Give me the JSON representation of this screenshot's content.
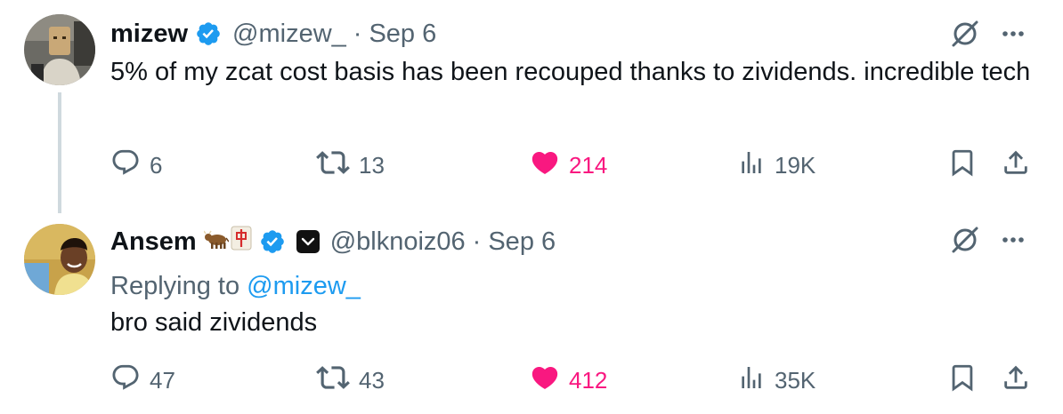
{
  "tweets": [
    {
      "display_name": "mizew",
      "handle": "@mizew_",
      "separator": "·",
      "date": "Sep 6",
      "text": "5% of my zcat cost basis has been recouped thanks to zividends. incredible tech",
      "actions": {
        "replies": "6",
        "retweets": "13",
        "likes": "214",
        "views": "19K"
      },
      "verified": true,
      "liked": true
    },
    {
      "display_name": "Ansem",
      "emojis": [
        "🐂",
        "🀄"
      ],
      "handle": "@blknoiz06",
      "separator": "·",
      "date": "Sep 6",
      "replying_prefix": "Replying to",
      "replying_to": "@mizew_",
      "text": "bro said zividends",
      "actions": {
        "replies": "47",
        "retweets": "43",
        "likes": "412",
        "views": "35K"
      },
      "verified": true,
      "liked": true
    }
  ],
  "colors": {
    "text": "#0f1419",
    "secondary": "#536471",
    "link": "#1d9bf0",
    "like": "#f91880",
    "verified": "#1d9bf0",
    "thread_line": "#cfd9de"
  },
  "icons": [
    "verified-badge-icon",
    "grok-icon",
    "more-icon",
    "reply-icon",
    "retweet-icon",
    "heart-icon",
    "views-icon",
    "bookmark-icon",
    "share-icon",
    "affiliate-badge-icon"
  ]
}
